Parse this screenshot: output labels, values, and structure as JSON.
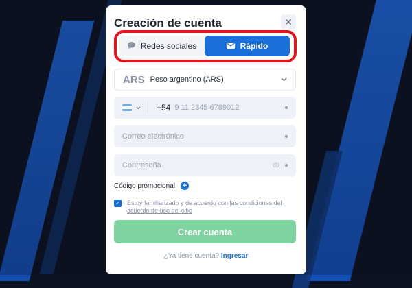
{
  "modal": {
    "title": "Creación de cuenta",
    "close_glyph": "✕"
  },
  "tabs": {
    "social_label": "Redes sociales",
    "social_icon": "chat-bubble-icon",
    "fast_label": "Rápido",
    "fast_icon": "envelope-icon",
    "active": "Rápido"
  },
  "currency": {
    "code": "ARS",
    "label": "Peso argentino (ARS)"
  },
  "phone": {
    "country_flag": "argentina-flag-icon",
    "prefix": "+54",
    "placeholder": "9 11 2345 6789012"
  },
  "email": {
    "placeholder": "Correo electrónico"
  },
  "password": {
    "placeholder": "Contraseña"
  },
  "promo": {
    "label": "Código promocional"
  },
  "agreement": {
    "checked": true,
    "text": "Estoy familiarizado y de acuerdo con",
    "link_text": "las condiciones del acuerdo de uso del sitio"
  },
  "submit": {
    "label": "Crear cuenta"
  },
  "login": {
    "question": "¿Ya tiene cuenta?",
    "link": "Ingresar"
  },
  "colors": {
    "background": "#0c1322",
    "accent_blue": "#1a6fd8",
    "highlight_red": "#e8121d",
    "submit_green": "#7fd3a0"
  }
}
